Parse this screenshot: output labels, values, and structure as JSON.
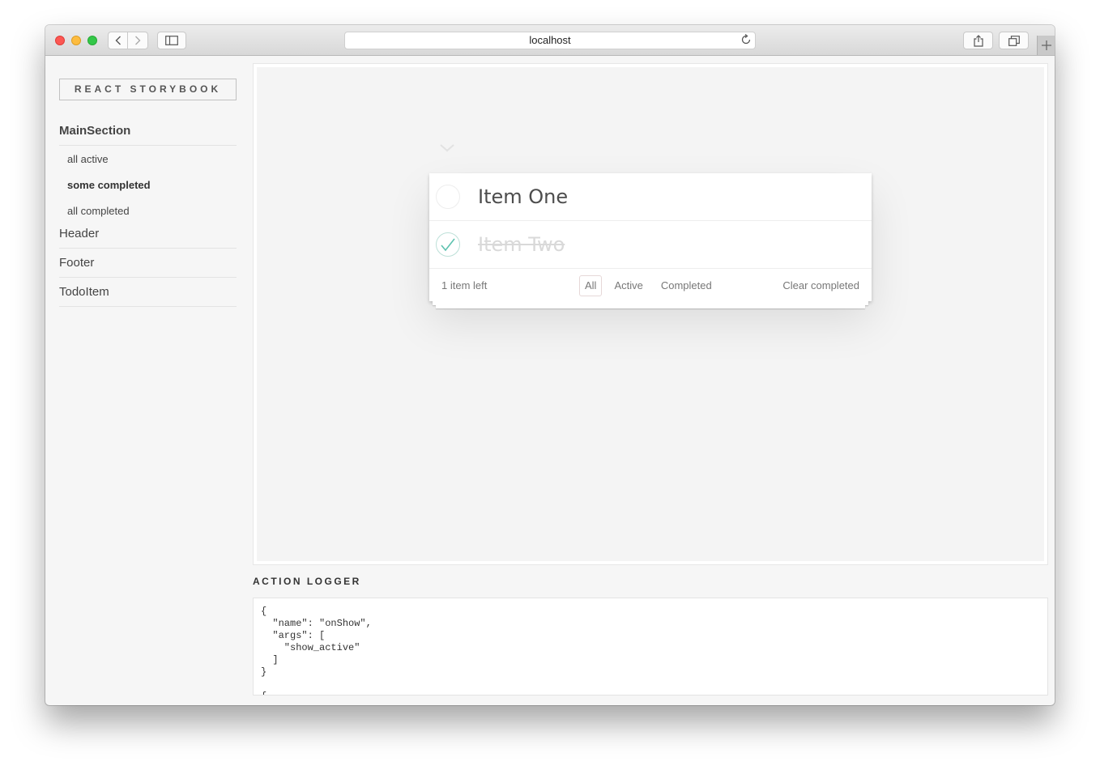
{
  "browser": {
    "url": "localhost"
  },
  "sidebar": {
    "brand": "REACT STORYBOOK",
    "kinds": [
      {
        "label": "MainSection",
        "stories": [
          "all active",
          "some completed",
          "all completed"
        ],
        "selected_story": "some completed"
      },
      {
        "label": "Header"
      },
      {
        "label": "Footer"
      },
      {
        "label": "TodoItem"
      }
    ]
  },
  "preview": {
    "todos": [
      {
        "text": "Item One",
        "completed": false
      },
      {
        "text": "Item Two",
        "completed": true
      }
    ],
    "footer": {
      "count": "1 item left",
      "filters": [
        "All",
        "Active",
        "Completed"
      ],
      "selected_filter": "All",
      "clear": "Clear completed"
    }
  },
  "logger": {
    "title": "ACTION LOGGER",
    "content": "{\n  \"name\": \"onShow\",\n  \"args\": [\n    \"show_active\"\n  ]\n}\n\n{"
  }
}
